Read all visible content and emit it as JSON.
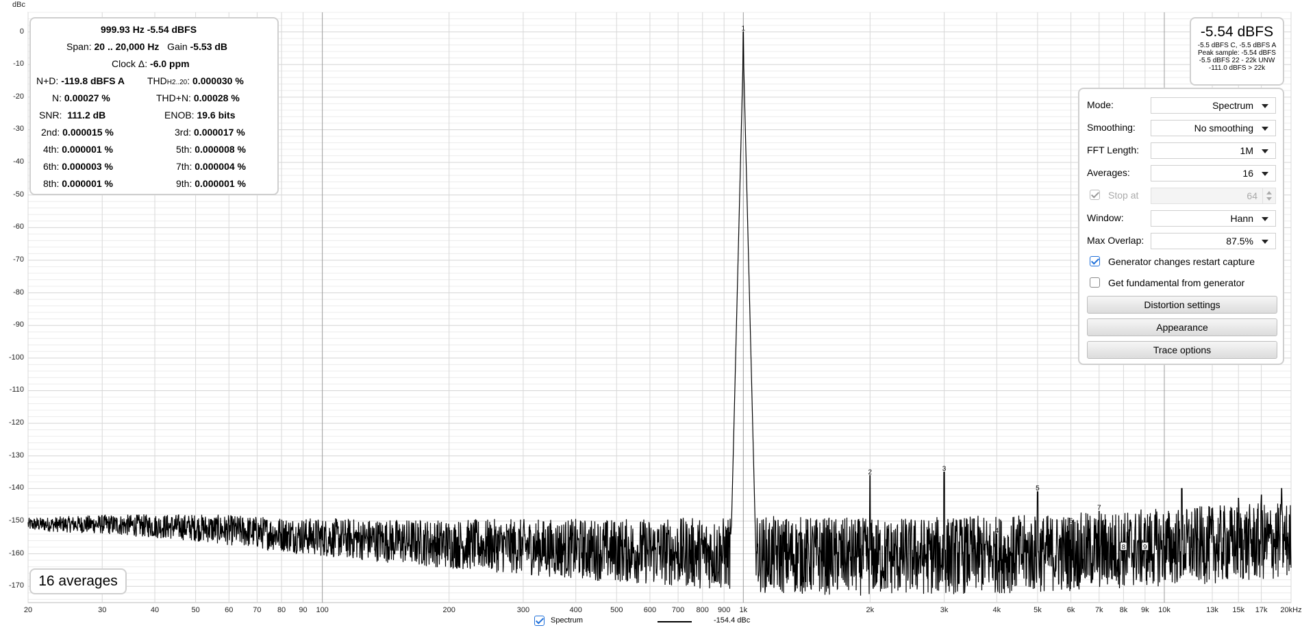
{
  "chart_data": {
    "type": "line",
    "ylabel": "dBc",
    "ylim": [
      -175,
      6
    ],
    "xlim": [
      20,
      20000
    ],
    "xscale": "log",
    "grid": true,
    "y_ticks": [
      0,
      -10,
      -20,
      -30,
      -40,
      -50,
      -60,
      -70,
      -80,
      -90,
      -100,
      -110,
      -120,
      -130,
      -140,
      -150,
      -160,
      -170
    ],
    "x_ticks": [
      {
        "v": 20,
        "label": "20"
      },
      {
        "v": 30,
        "label": "30"
      },
      {
        "v": 40,
        "label": "40"
      },
      {
        "v": 50,
        "label": "50"
      },
      {
        "v": 60,
        "label": "60"
      },
      {
        "v": 70,
        "label": "70"
      },
      {
        "v": 80,
        "label": "80"
      },
      {
        "v": 90,
        "label": "90"
      },
      {
        "v": 100,
        "label": "100"
      },
      {
        "v": 200,
        "label": "200"
      },
      {
        "v": 300,
        "label": "300"
      },
      {
        "v": 400,
        "label": "400"
      },
      {
        "v": 500,
        "label": "500"
      },
      {
        "v": 600,
        "label": "600"
      },
      {
        "v": 700,
        "label": "700"
      },
      {
        "v": 800,
        "label": "800"
      },
      {
        "v": 900,
        "label": "900"
      },
      {
        "v": 1000,
        "label": "1k"
      },
      {
        "v": 2000,
        "label": "2k"
      },
      {
        "v": 3000,
        "label": "3k"
      },
      {
        "v": 4000,
        "label": "4k"
      },
      {
        "v": 5000,
        "label": "5k"
      },
      {
        "v": 6000,
        "label": "6k"
      },
      {
        "v": 7000,
        "label": "7k"
      },
      {
        "v": 8000,
        "label": "8k"
      },
      {
        "v": 9000,
        "label": "9k"
      },
      {
        "v": 10000,
        "label": "10k"
      },
      {
        "v": 13000,
        "label": "13k"
      },
      {
        "v": 15000,
        "label": "15k"
      },
      {
        "v": 17000,
        "label": "17k"
      },
      {
        "v": 20000,
        "label": "20kHz"
      }
    ],
    "series": [
      {
        "name": "Spectrum",
        "color": "#000000",
        "noise_floor": [
          {
            "x": 20,
            "y": -151
          },
          {
            "x": 30,
            "y": -151
          },
          {
            "x": 50,
            "y": -152
          },
          {
            "x": 100,
            "y": -155
          },
          {
            "x": 200,
            "y": -157
          },
          {
            "x": 500,
            "y": -159
          },
          {
            "x": 900,
            "y": -160
          },
          {
            "x": 2000,
            "y": -161
          },
          {
            "x": 5000,
            "y": -160
          },
          {
            "x": 10000,
            "y": -158
          },
          {
            "x": 20000,
            "y": -156
          }
        ],
        "peaks": [
          {
            "x": 1000,
            "y": 0,
            "label": "1"
          },
          {
            "x": 2000,
            "y": -136,
            "label": "2"
          },
          {
            "x": 3000,
            "y": -135,
            "label": "3"
          },
          {
            "x": 4000,
            "y": -154,
            "label": "4"
          },
          {
            "x": 5000,
            "y": -141,
            "label": "5"
          },
          {
            "x": 6000,
            "y": -151,
            "label": "6"
          },
          {
            "x": 7000,
            "y": -147,
            "label": "7"
          },
          {
            "x": 8000,
            "y": -159,
            "label": "8"
          },
          {
            "x": 9000,
            "y": -159,
            "label": "9"
          },
          {
            "x": 11000,
            "y": -140,
            "label": ""
          },
          {
            "x": 15000,
            "y": -143,
            "label": ""
          },
          {
            "x": 17000,
            "y": -142,
            "label": ""
          },
          {
            "x": 19000,
            "y": -140,
            "label": ""
          }
        ]
      }
    ]
  },
  "stats": {
    "fundamental": "999.93 Hz  -5.54 dBFS",
    "span_label": "Span:",
    "span_value": "20 .. 20,000 Hz",
    "gain_label": "Gain",
    "gain_value": "-5.53 dB",
    "clock_label": "Clock Δ:",
    "clock_value": "-6.0 ppm",
    "nd_label": "N+D:",
    "nd_value": "-119.8 dBFS A",
    "thd_label": "THD",
    "thd_sub": "H2..20",
    "thd_value": "0.000030 %",
    "n_label": "N:",
    "n_value": "0.00027 %",
    "thdn_label": "THD+N:",
    "thdn_value": "0.00028 %",
    "snr_label": "SNR:",
    "snr_value": "111.2 dB",
    "enob_label": "ENOB:",
    "enob_value": "19.6 bits",
    "h2_label": "2nd:",
    "h2_value": "0.000015 %",
    "h3_label": "3rd:",
    "h3_value": "0.000017 %",
    "h4_label": "4th:",
    "h4_value": "0.000001 %",
    "h5_label": "5th:",
    "h5_value": "0.000008 %",
    "h6_label": "6th:",
    "h6_value": "0.000003 %",
    "h7_label": "7th:",
    "h7_value": "0.000004 %",
    "h8_label": "8th:",
    "h8_value": "0.000001 %",
    "h9_label": "9th:",
    "h9_value": "0.000001 %"
  },
  "level": {
    "main": "-5.54 dBFS",
    "line1": "-5.5 dBFS C, -5.5 dBFS A",
    "line2": "Peak sample: -5.54 dBFS",
    "line3": "-5.5 dBFS 22 - 22k UNW",
    "line4": "-111.0 dBFS > 22k"
  },
  "controls": {
    "mode_label": "Mode:",
    "mode_value": "Spectrum",
    "smoothing_label": "Smoothing:",
    "smoothing_value": "No smoothing",
    "fft_label": "FFT Length:",
    "fft_value": "1M",
    "averages_label": "Averages:",
    "averages_value": "16",
    "stop_label": "Stop at",
    "stop_value": "64",
    "window_label": "Window:",
    "window_value": "Hann",
    "overlap_label": "Max Overlap:",
    "overlap_value": "87.5%",
    "gen_restart_label": "Generator changes restart capture",
    "gen_fund_label": "Get fundamental from generator",
    "distortion_btn": "Distortion settings",
    "appearance_btn": "Appearance",
    "trace_btn": "Trace options"
  },
  "averages_badge": "16 averages",
  "legend": {
    "series_label": "Spectrum",
    "series_value": "-154.4 dBc"
  }
}
